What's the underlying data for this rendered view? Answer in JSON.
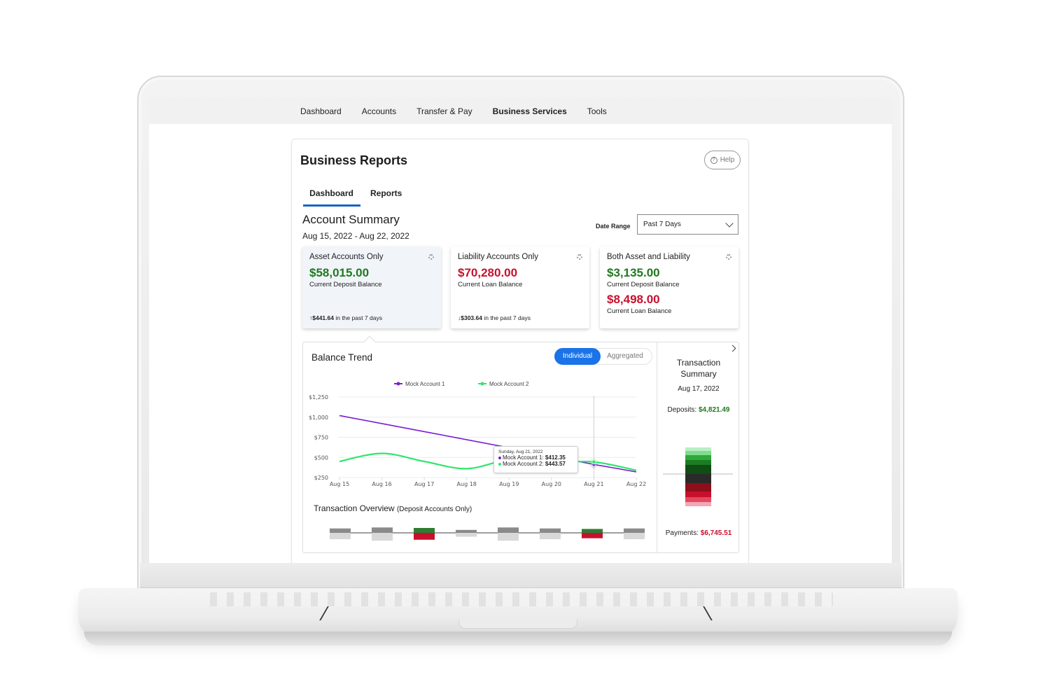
{
  "nav": {
    "items": [
      {
        "label": "Dashboard",
        "active": false
      },
      {
        "label": "Accounts",
        "active": false
      },
      {
        "label": "Transfer & Pay",
        "active": false
      },
      {
        "label": "Business Services",
        "active": true
      },
      {
        "label": "Tools",
        "active": false
      }
    ]
  },
  "page": {
    "title": "Business Reports",
    "help_label": "Help",
    "help_icon": "question-circle-icon"
  },
  "tabs": [
    {
      "label": "Dashboard",
      "active": true
    },
    {
      "label": "Reports",
      "active": false
    }
  ],
  "summary": {
    "title": "Account Summary",
    "range": "Aug 15, 2022 - Aug 22, 2022",
    "date_range_label": "Date Range",
    "date_range_value": "Past 7 Days"
  },
  "cards": [
    {
      "title": "Asset Accounts Only",
      "amount": "$58,015.00",
      "amount_color": "#1f7a1f",
      "sublabel": "Current Deposit Balance",
      "change_icon": "arrow-up-icon",
      "change_arrow": "↑",
      "change_amount": "$441.64",
      "change_text": " in the past 7 days",
      "selected": true
    },
    {
      "title": "Liability Accounts Only",
      "amount": "$70,280.00",
      "amount_color": "#c8102e",
      "sublabel": "Current Loan Balance",
      "change_icon": "arrow-down-icon",
      "change_arrow": "↓",
      "change_amount": "$303.64",
      "change_text": " in the past 7 days",
      "selected": false
    },
    {
      "title": "Both Asset and Liability",
      "amount": "$3,135.00",
      "amount_color": "#1f7a1f",
      "sublabel": "Current Deposit Balance",
      "amount2": "$8,498.00",
      "amount2_color": "#c8102e",
      "sublabel2": "Current Loan Balance",
      "selected": false
    }
  ],
  "trend": {
    "title": "Balance Trend",
    "toggle": [
      {
        "label": "Individual",
        "active": true
      },
      {
        "label": "Aggregated",
        "active": false
      }
    ],
    "tooltip": {
      "date": "Sunday, Aug 21, 2022",
      "rows": [
        {
          "label": "Mock Account 1: ",
          "value": "$412.35",
          "color": "#7b1fd1"
        },
        {
          "label": "Mock Account 2: ",
          "value": "$443.57",
          "color": "#2ee66b"
        }
      ]
    }
  },
  "chart_data": {
    "type": "line",
    "title": "Balance Trend",
    "xlabel": "",
    "ylabel": "",
    "categories": [
      "Aug 15",
      "Aug 16",
      "Aug 17",
      "Aug 18",
      "Aug 19",
      "Aug 20",
      "Aug 21",
      "Aug 22"
    ],
    "y_ticks": [
      "$250",
      "$500",
      "$750",
      "$1,000",
      "$1,250"
    ],
    "y_tick_values": [
      250,
      500,
      750,
      1000,
      1250
    ],
    "ylim": [
      250,
      1250
    ],
    "grid": true,
    "legend_position": "top-center",
    "highlight_index": 6,
    "series": [
      {
        "name": "Mock Account 1",
        "color": "#7b1fd1",
        "values": [
          1020,
          920,
          820,
          720,
          620,
          515,
          412.35,
          320
        ]
      },
      {
        "name": "Mock Account 2",
        "color": "#2ee66b",
        "values": [
          450,
          550,
          450,
          360,
          470,
          440,
          443.57,
          340
        ]
      }
    ]
  },
  "overview": {
    "title": "Transaction Overview",
    "subtitle": "(Deposit Accounts Only)",
    "days": [
      {
        "up": 0.45,
        "down": 0.65,
        "highlight": false
      },
      {
        "up": 0.55,
        "down": 0.8,
        "highlight": false
      },
      {
        "up": 0.5,
        "down": 0.7,
        "highlight": true
      },
      {
        "up": 0.3,
        "down": 0.4,
        "highlight": false
      },
      {
        "up": 0.55,
        "down": 0.8,
        "highlight": false
      },
      {
        "up": 0.45,
        "down": 0.65,
        "highlight": false
      },
      {
        "up": 0.4,
        "down": 0.55,
        "highlight": true
      },
      {
        "up": 0.45,
        "down": 0.65,
        "highlight": false
      }
    ]
  },
  "transaction_summary": {
    "title_line1": "Transaction",
    "title_line2": "Summary",
    "date": "Aug 17, 2022",
    "deposits_label": "Deposits: ",
    "deposits_value": "$4,821.49",
    "payments_label": "Payments: ",
    "payments_value": "$6,745.51",
    "deposit_bands": [
      "#b8efc4",
      "#7fdc8f",
      "#2fa83a",
      "#1b7c24",
      "#0f4d14"
    ],
    "payment_bands": [
      "#2a2a2a",
      "#8d0f1a",
      "#c8102e",
      "#e24b5e",
      "#f3a6b8"
    ]
  }
}
